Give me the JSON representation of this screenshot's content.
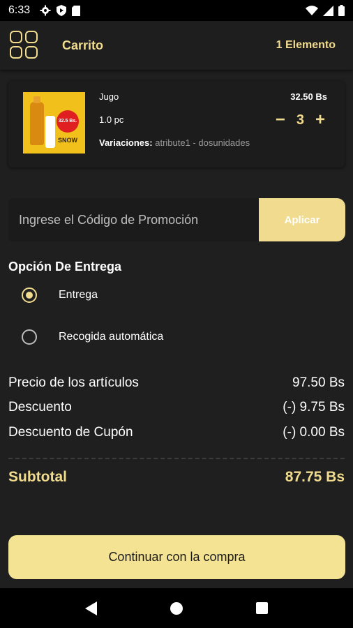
{
  "status_bar": {
    "time": "6:33",
    "left_icons": [
      "gear-icon",
      "shield-icon",
      "sd-card-icon"
    ],
    "right_icons": [
      "wifi-icon",
      "signal-icon",
      "battery-icon"
    ]
  },
  "header": {
    "title": "Carrito",
    "item_count": "1 Elemento"
  },
  "cart_items": [
    {
      "name": "Jugo",
      "unit": "1.0 pc",
      "price": "32.50 Bs",
      "quantity": "3",
      "variations_label": "Variaciones:",
      "variations_value": "atribute1 - dosunidades",
      "image_badge": "32.5 Bs.",
      "image_brand": "SNOW"
    }
  ],
  "promo": {
    "placeholder": "Ingrese el Código de Promoción",
    "apply_label": "Aplicar"
  },
  "delivery": {
    "title": "Opción De Entrega",
    "options": [
      {
        "label": "Entrega",
        "selected": true
      },
      {
        "label": "Recogida automática",
        "selected": false
      }
    ]
  },
  "summary": {
    "items_price_label": "Precio de los artículos",
    "items_price_value": "97.50 Bs",
    "discount_label": "Descuento",
    "discount_value": "(-) 9.75 Bs",
    "coupon_label": "Descuento de Cupón",
    "coupon_value": "(-) 0.00 Bs",
    "subtotal_label": "Subtotal",
    "subtotal_value": "87.75 Bs"
  },
  "continue_label": "Continuar con la compra",
  "colors": {
    "accent": "#f0db8e",
    "background": "#1f1f1f",
    "button": "#f4e393"
  }
}
